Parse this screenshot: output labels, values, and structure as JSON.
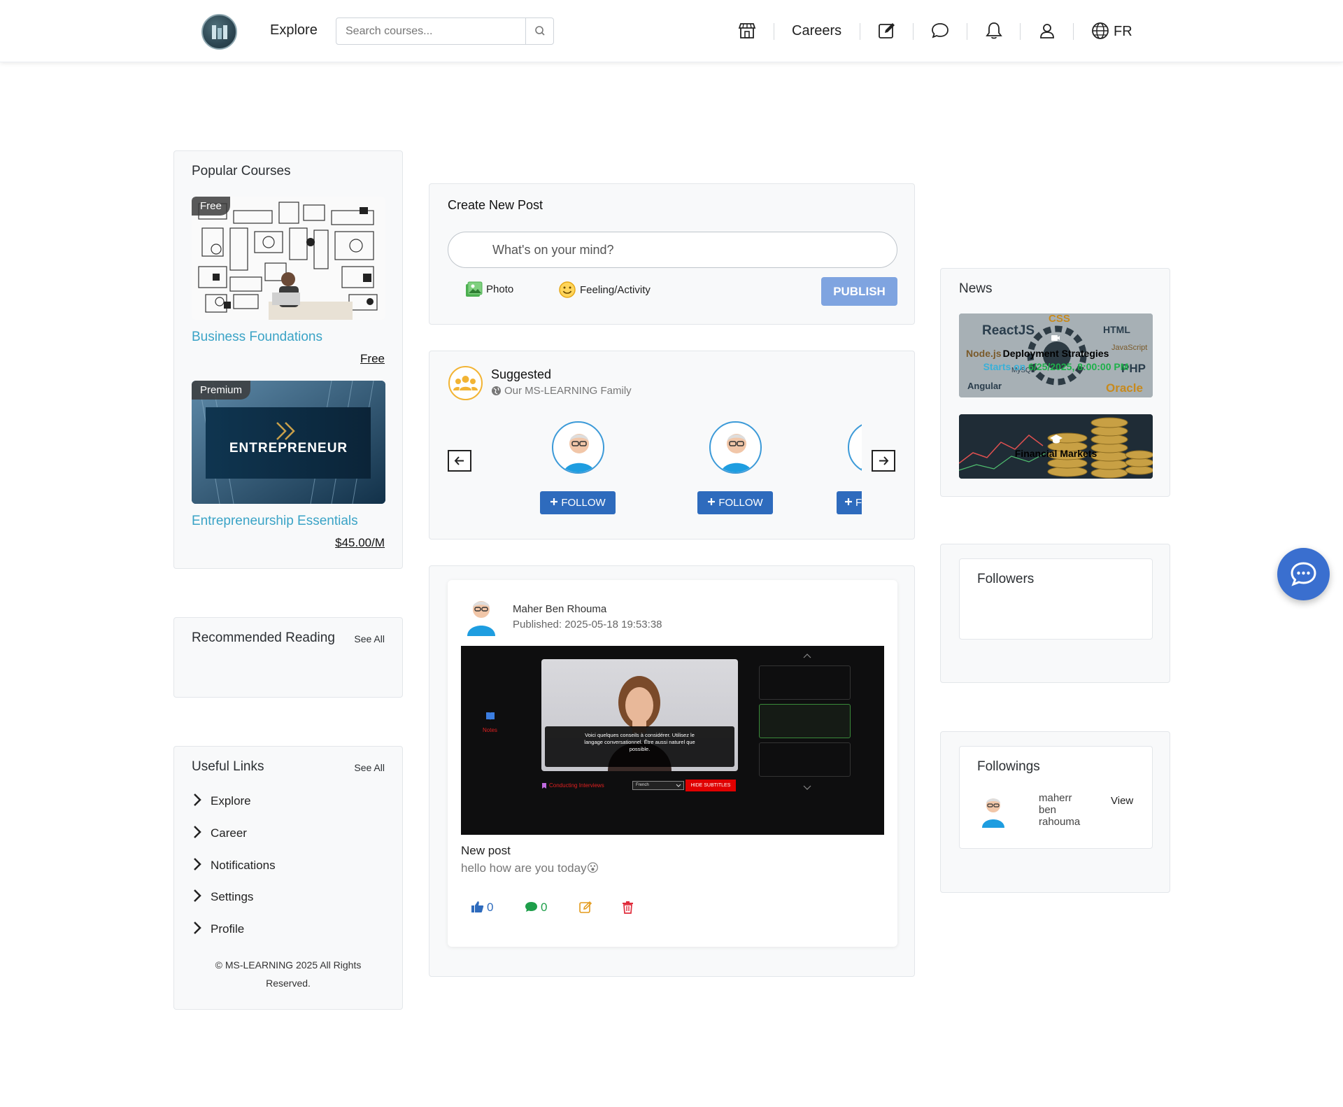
{
  "nav": {
    "explore": "Explore",
    "search_placeholder": "Search courses...",
    "careers": "Careers",
    "lang": "FR",
    "icons": [
      "store-icon",
      "edit-icon",
      "chat-icon",
      "bell-icon",
      "user-icon",
      "globe-icon"
    ]
  },
  "popular": {
    "title": "Popular Courses",
    "courses": [
      {
        "badge": "Free",
        "name": "Business Foundations",
        "price": "Free"
      },
      {
        "badge": "Premium",
        "name": "Entrepreneurship Essentials",
        "price": "$45.00/M",
        "banner": "ENTREPRENEUR"
      }
    ]
  },
  "reading": {
    "title": "Recommended Reading",
    "see_all": "See All"
  },
  "links": {
    "title": "Useful Links",
    "see_all": "See All",
    "items": [
      "Explore",
      "Career",
      "Notifications",
      "Settings",
      "Profile"
    ],
    "copyright_line1": "© MS-LEARNING 2025 All Rights",
    "copyright_line2": "Reserved."
  },
  "create_post": {
    "title": "Create New Post",
    "placeholder": "What's on your mind?",
    "photo": "Photo",
    "feeling": "Feeling/Activity",
    "publish": "PUBLISH"
  },
  "suggested": {
    "title": "Suggested",
    "subtitle": "Our MS-LEARNING Family",
    "follow": "FOLLOW",
    "follow_partial": "FO"
  },
  "post": {
    "author": "Maher Ben Rhouma",
    "published": "Published: 2025-05-18 19:53:38",
    "title": "New post",
    "body": "hello how are you today😮",
    "likes": "0",
    "comments": "0",
    "video": {
      "notes": "Notes",
      "subtitle": "Voici quelques conseils à considérer. Utilisez le langage conversationnel. Être aussi naturel que possible.",
      "chapter": "Conducting Interviews",
      "language": "French",
      "hide_subtitles": "HIDE SUBTITLES"
    }
  },
  "news": {
    "title": "News",
    "items": [
      {
        "title": "Deployment Strategies",
        "starts_label": "Starts on",
        "date": "6/25/2025, 8:00:00 PM"
      },
      {
        "title": "Financial Markets"
      }
    ]
  },
  "followers": {
    "title": "Followers"
  },
  "followings": {
    "title": "Followings",
    "user_line1": "maherr",
    "user_line2": "ben",
    "user_line3": "rahouma",
    "view": "View"
  },
  "colors": {
    "primary": "#2e6bbd",
    "link": "#3aa3c6",
    "publish": "#7fa4e0",
    "fab": "#3a6fcf"
  }
}
